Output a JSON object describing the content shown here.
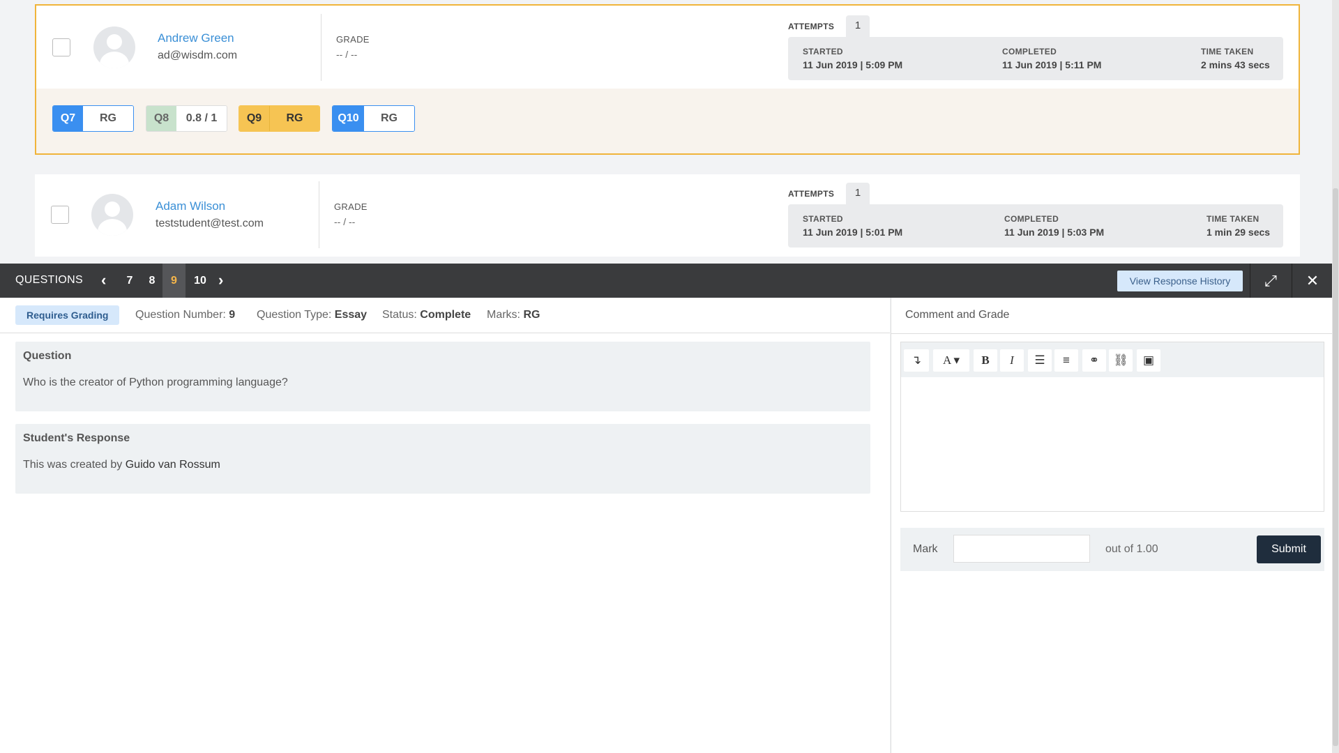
{
  "students": [
    {
      "name": "Andrew Green",
      "email": "ad@wisdm.com",
      "grade_label": "GRADE",
      "grade_value": "-- / --",
      "attempts_label": "ATTEMPTS",
      "attempts": "1",
      "started_label": "STARTED",
      "started": "11 Jun 2019 | 5:09 PM",
      "completed_label": "COMPLETED",
      "completed": "11 Jun 2019 | 5:11 PM",
      "time_label": "TIME TAKEN",
      "time": "2 mins 43 secs",
      "questions": [
        {
          "num": "Q7",
          "value": "RG"
        },
        {
          "num": "Q8",
          "value": "0.8 / 1"
        },
        {
          "num": "Q9",
          "value": "RG"
        },
        {
          "num": "Q10",
          "value": "RG"
        }
      ]
    },
    {
      "name": "Adam Wilson",
      "email": "teststudent@test.com",
      "grade_label": "GRADE",
      "grade_value": "-- / --",
      "attempts_label": "ATTEMPTS",
      "attempts": "1",
      "started_label": "STARTED",
      "started": "11 Jun 2019 | 5:01 PM",
      "completed_label": "COMPLETED",
      "completed": "11 Jun 2019 | 5:03 PM",
      "time_label": "TIME TAKEN",
      "time": "1 min 29 secs"
    }
  ],
  "questions_bar": {
    "title": "QUESTIONS",
    "nav": [
      "7",
      "8",
      "9",
      "10"
    ],
    "active": "9",
    "view_history": "View Response History"
  },
  "info": {
    "badge": "Requires Grading",
    "number_label": "Question Number:",
    "number": "9",
    "type_label": "Question Type:",
    "type": "Essay",
    "status_label": "Status:",
    "status": "Complete",
    "marks_label": "Marks:",
    "marks": "RG"
  },
  "question": {
    "heading": "Question",
    "text": "Who is the creator of Python programming language?"
  },
  "response": {
    "heading": "Student's Response",
    "prefix": "This was created by ",
    "answer": "Guido van Rossum"
  },
  "grading": {
    "title": "Comment and Grade",
    "mark_label": "Mark",
    "mark_value": "",
    "out_of": "out of 1.00",
    "submit": "Submit"
  },
  "colors": {
    "selected_border": "#f0b43a",
    "accent_blue": "#3a8ff0",
    "amber": "#f6c453",
    "dark_bar": "#3a3b3d",
    "submit": "#1f2d3d"
  }
}
